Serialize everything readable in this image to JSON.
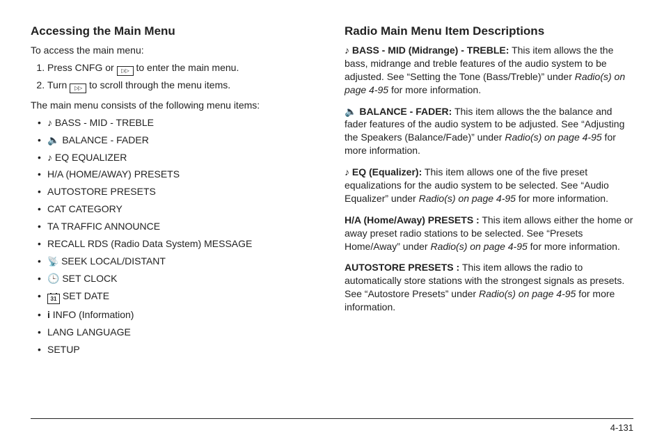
{
  "left": {
    "heading": "Accessing the Main Menu",
    "intro": "To access the main menu:",
    "step1_a": "Press CNFG or ",
    "step1_b": " to enter the main menu.",
    "step2_a": "Turn ",
    "step2_b": " to scroll through the menu items.",
    "listIntro": "The main menu consists of the following menu items:",
    "items": {
      "bass": "BASS - MID - TREBLE",
      "balance": "BALANCE - FADER",
      "eq": "EQ EQUALIZER",
      "ha": "H/A (HOME/AWAY) PRESETS",
      "auto": "AUTOSTORE PRESETS",
      "cat": "CAT CATEGORY",
      "ta": "TA TRAFFIC ANNOUNCE",
      "rds": "RECALL RDS (Radio Data System) MESSAGE",
      "seek": "SEEK LOCAL/DISTANT",
      "clock": "SET CLOCK",
      "date": "SET DATE",
      "info": "INFO (Information)",
      "lang": "LANG LANGUAGE",
      "setup": "SETUP"
    }
  },
  "right": {
    "heading": "Radio Main Menu Item Descriptions",
    "bass": {
      "lead": "BASS - MID (Midrange) - TREBLE:",
      "body_a": "  This item allows the the bass, midrange and treble features of the audio system to be adjusted. See “Setting the Tone (Bass/Treble)” under ",
      "ref": "Radio(s) on page 4-95",
      "body_b": " for more information."
    },
    "balance": {
      "lead": "BALANCE - FADER:",
      "body_a": "  This item allows the the balance and fader features of the audio system to be adjusted. See “Adjusting the Speakers (Balance/Fade)” under ",
      "ref": "Radio(s) on page 4-95",
      "body_b": " for more information."
    },
    "eq": {
      "lead": "EQ (Equalizer):",
      "body_a": "  This item allows one of the five preset equalizations for the audio system to be selected. See “Audio Equalizer” under ",
      "ref": "Radio(s) on page 4-95",
      "body_b": " for more information."
    },
    "ha": {
      "lead": "H/A (Home/Away) PRESETS :",
      "body_a": "  This item allows either the home or away preset radio stations to be selected. See “Presets Home/Away” under ",
      "ref": "Radio(s) on page 4-95",
      "body_b": " for more information."
    },
    "auto": {
      "lead": "AUTOSTORE PRESETS :",
      "body_a": "  This item allows the radio to automatically store stations with the strongest signals as presets. See “Autostore Presets” under ",
      "ref": "Radio(s) on page 4-95",
      "body_b": " for more information."
    }
  },
  "pageNumber": "4-131",
  "icons": {
    "calendar_num": "31"
  }
}
